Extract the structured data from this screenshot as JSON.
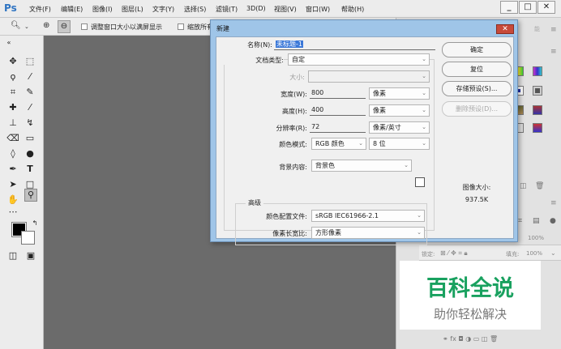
{
  "app": {
    "logo": "Ps"
  },
  "menu": [
    "文件(F)",
    "编辑(E)",
    "图像(I)",
    "图层(L)",
    "文字(Y)",
    "选择(S)",
    "滤镜(T)",
    "3D(D)",
    "视图(V)",
    "窗口(W)",
    "帮助(H)"
  ],
  "window_controls": {
    "minimize": "_",
    "maximize": "□",
    "close": "✕"
  },
  "options": {
    "resize_window": "调整窗口大小以满屏显示",
    "zoom_all": "缩放所有"
  },
  "dialog": {
    "title": "新建",
    "close": "✕",
    "name_label": "名称(N):",
    "name_value": "未标题-1",
    "doc_type_label": "文档类型:",
    "doc_type_value": "自定",
    "size_label": "大小:",
    "width_label": "宽度(W):",
    "width_value": "800",
    "width_unit": "像素",
    "height_label": "高度(H):",
    "height_value": "400",
    "height_unit": "像素",
    "resolution_label": "分辨率(R):",
    "resolution_value": "72",
    "resolution_unit": "像素/英寸",
    "color_mode_label": "颜色模式:",
    "color_mode_value": "RGB 颜色",
    "bit_depth_value": "8 位",
    "bg_content_label": "背景内容:",
    "bg_content_value": "背景色",
    "advanced_label": "高级",
    "color_profile_label": "颜色配置文件:",
    "color_profile_value": "sRGB IEC61966-2.1",
    "pixel_aspect_label": "像素长宽比:",
    "pixel_aspect_value": "方形像素",
    "ok": "确定",
    "reset": "复位",
    "save_preset": "存储预设(S)...",
    "delete_preset": "删除预设(D)...",
    "image_size_label": "图像大小:",
    "image_size_value": "937.5K"
  },
  "right_panel": {
    "opacity": "100%",
    "fill": "100%",
    "lock_label": "锁定:",
    "fill_label": "填充:"
  },
  "watermark": {
    "main": "百科全说",
    "sub": "助你轻松解决"
  }
}
